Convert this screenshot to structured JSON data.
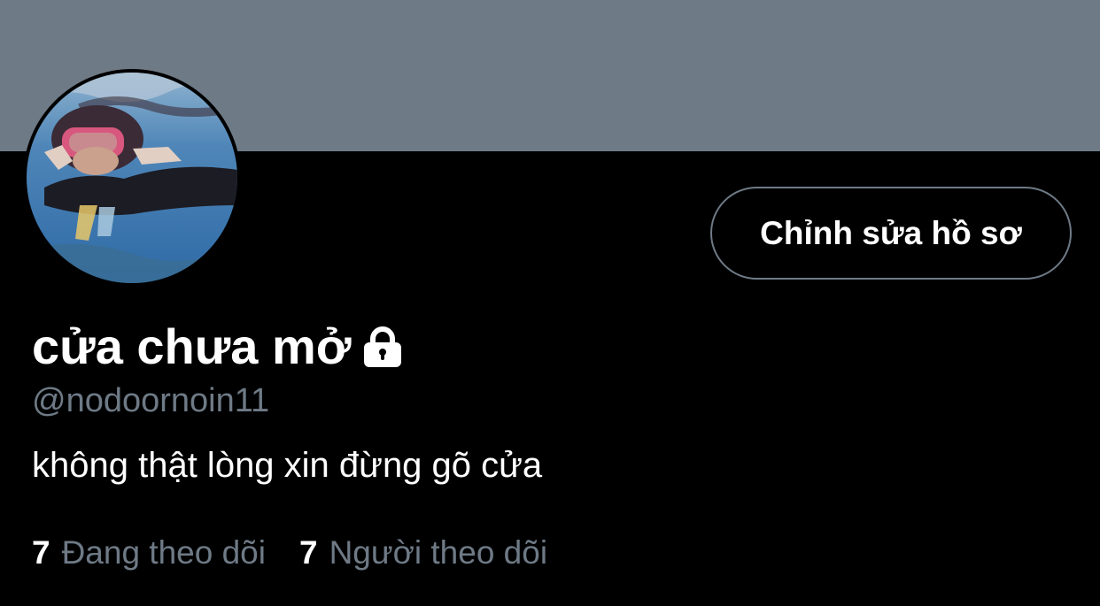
{
  "profile": {
    "display_name": "cửa chưa mở",
    "handle": "@nodoornoin11",
    "bio": "không thật lòng xin đừng gõ cửa",
    "protected_icon": "lock-icon",
    "avatar_description": "avatar-photo"
  },
  "actions": {
    "edit_profile_label": "Chỉnh sửa hồ sơ"
  },
  "stats": {
    "following_count": "7",
    "following_label": "Đang theo dõi",
    "followers_count": "7",
    "followers_label": "Người theo dõi"
  },
  "colors": {
    "background": "#000000",
    "banner": "#6e7a86",
    "primary_text": "#ffffff",
    "secondary_text": "#6e7a86",
    "button_border": "#6e7a86"
  }
}
